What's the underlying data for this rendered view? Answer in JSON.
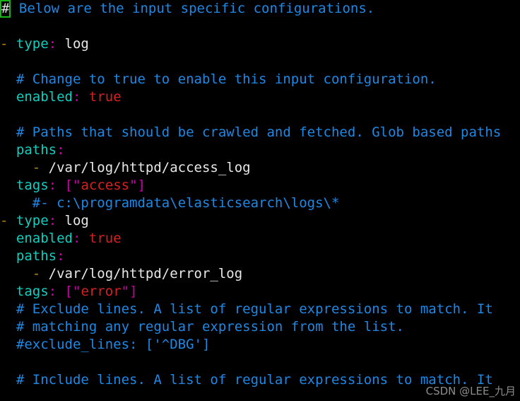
{
  "terminal": {
    "background_color": "#000000",
    "font_size_px": 19,
    "line_height_px": 25,
    "cursor": {
      "char": "#",
      "row": 0,
      "col": 0,
      "border_color": "#19b319",
      "char_color": "#e0e0e0"
    },
    "colors": {
      "comment": "#1e88e5",
      "key": "#0fd0c0",
      "punctuation": "#cc00a8",
      "plain": "#e8e8e8",
      "boolean": "#d82020",
      "string": "#d82020",
      "list_dash": "#b8860b"
    }
  },
  "watermark": {
    "text": "CSDN @LEE_九月"
  },
  "lines": [
    {
      "index": 0,
      "tokens": [
        {
          "text": "#",
          "kind": "cursor"
        },
        {
          "text": " Below are the input specific configurations.",
          "kind": "comment"
        }
      ]
    },
    {
      "index": 1,
      "tokens": [
        {
          "text": "",
          "kind": "plain"
        }
      ]
    },
    {
      "index": 2,
      "tokens": [
        {
          "text": "- ",
          "kind": "dash"
        },
        {
          "text": "type",
          "kind": "key"
        },
        {
          "text": ":",
          "kind": "punct"
        },
        {
          "text": " log",
          "kind": "plain"
        }
      ]
    },
    {
      "index": 3,
      "tokens": [
        {
          "text": "",
          "kind": "plain"
        }
      ]
    },
    {
      "index": 4,
      "tokens": [
        {
          "text": "  # Change to true to enable this input configuration.",
          "kind": "comment"
        }
      ]
    },
    {
      "index": 5,
      "tokens": [
        {
          "text": "  ",
          "kind": "plain"
        },
        {
          "text": "enabled",
          "kind": "key"
        },
        {
          "text": ":",
          "kind": "punct"
        },
        {
          "text": " ",
          "kind": "plain"
        },
        {
          "text": "true",
          "kind": "bool"
        }
      ]
    },
    {
      "index": 6,
      "tokens": [
        {
          "text": "",
          "kind": "plain"
        }
      ]
    },
    {
      "index": 7,
      "tokens": [
        {
          "text": "  # Paths that should be crawled and fetched. Glob based paths",
          "kind": "comment"
        }
      ]
    },
    {
      "index": 8,
      "tokens": [
        {
          "text": "  ",
          "kind": "plain"
        },
        {
          "text": "paths",
          "kind": "key"
        },
        {
          "text": ":",
          "kind": "punct"
        }
      ]
    },
    {
      "index": 9,
      "tokens": [
        {
          "text": "    - ",
          "kind": "dash"
        },
        {
          "text": "/var/log/httpd/access_log",
          "kind": "plain"
        }
      ]
    },
    {
      "index": 10,
      "tokens": [
        {
          "text": "  ",
          "kind": "plain"
        },
        {
          "text": "tags",
          "kind": "key"
        },
        {
          "text": ":",
          "kind": "punct"
        },
        {
          "text": " ",
          "kind": "plain"
        },
        {
          "text": "[",
          "kind": "punct"
        },
        {
          "text": "\"",
          "kind": "punct"
        },
        {
          "text": "access",
          "kind": "str"
        },
        {
          "text": "\"",
          "kind": "punct"
        },
        {
          "text": "]",
          "kind": "punct"
        }
      ]
    },
    {
      "index": 11,
      "tokens": [
        {
          "text": "    #- c:\\programdata\\elasticsearch\\logs\\*",
          "kind": "comment"
        }
      ]
    },
    {
      "index": 12,
      "tokens": [
        {
          "text": "- ",
          "kind": "dash"
        },
        {
          "text": "type",
          "kind": "key"
        },
        {
          "text": ":",
          "kind": "punct"
        },
        {
          "text": " log",
          "kind": "plain"
        }
      ]
    },
    {
      "index": 13,
      "tokens": [
        {
          "text": "  ",
          "kind": "plain"
        },
        {
          "text": "enabled",
          "kind": "key"
        },
        {
          "text": ":",
          "kind": "punct"
        },
        {
          "text": " ",
          "kind": "plain"
        },
        {
          "text": "true",
          "kind": "bool"
        }
      ]
    },
    {
      "index": 14,
      "tokens": [
        {
          "text": "  ",
          "kind": "plain"
        },
        {
          "text": "paths",
          "kind": "key"
        },
        {
          "text": ":",
          "kind": "punct"
        }
      ]
    },
    {
      "index": 15,
      "tokens": [
        {
          "text": "    - ",
          "kind": "dash"
        },
        {
          "text": "/var/log/httpd/error_log",
          "kind": "plain"
        }
      ]
    },
    {
      "index": 16,
      "tokens": [
        {
          "text": "  ",
          "kind": "plain"
        },
        {
          "text": "tags",
          "kind": "key"
        },
        {
          "text": ":",
          "kind": "punct"
        },
        {
          "text": " ",
          "kind": "plain"
        },
        {
          "text": "[",
          "kind": "punct"
        },
        {
          "text": "\"",
          "kind": "punct"
        },
        {
          "text": "error",
          "kind": "str"
        },
        {
          "text": "\"",
          "kind": "punct"
        },
        {
          "text": "]",
          "kind": "punct"
        }
      ]
    },
    {
      "index": 17,
      "tokens": [
        {
          "text": "  # Exclude lines. A list of regular expressions to match. It",
          "kind": "comment"
        }
      ]
    },
    {
      "index": 18,
      "tokens": [
        {
          "text": "  # matching any regular expression from the list.",
          "kind": "comment"
        }
      ]
    },
    {
      "index": 19,
      "tokens": [
        {
          "text": "  #exclude_lines: ['^DBG']",
          "kind": "comment"
        }
      ]
    },
    {
      "index": 20,
      "tokens": [
        {
          "text": "",
          "kind": "plain"
        }
      ]
    },
    {
      "index": 21,
      "tokens": [
        {
          "text": "  # Include lines. A list of regular expressions to match. It",
          "kind": "comment"
        }
      ]
    }
  ]
}
